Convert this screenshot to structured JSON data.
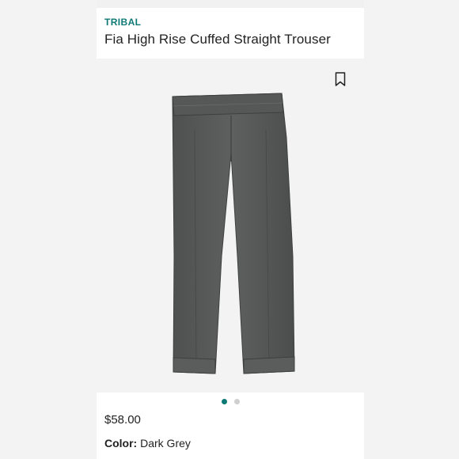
{
  "product": {
    "brand": "TRIBAL",
    "title": "Fia High Rise Cuffed Straight Trouser",
    "price": "$58.00",
    "color_label": "Color:",
    "color_value": "Dark Grey"
  },
  "carousel": {
    "total": 2,
    "active_index": 0
  },
  "icons": {
    "save": "bookmark-icon"
  },
  "colors": {
    "accent": "#0f7a74",
    "garment": "#5a5b5b",
    "background": "#f3f3f3"
  }
}
